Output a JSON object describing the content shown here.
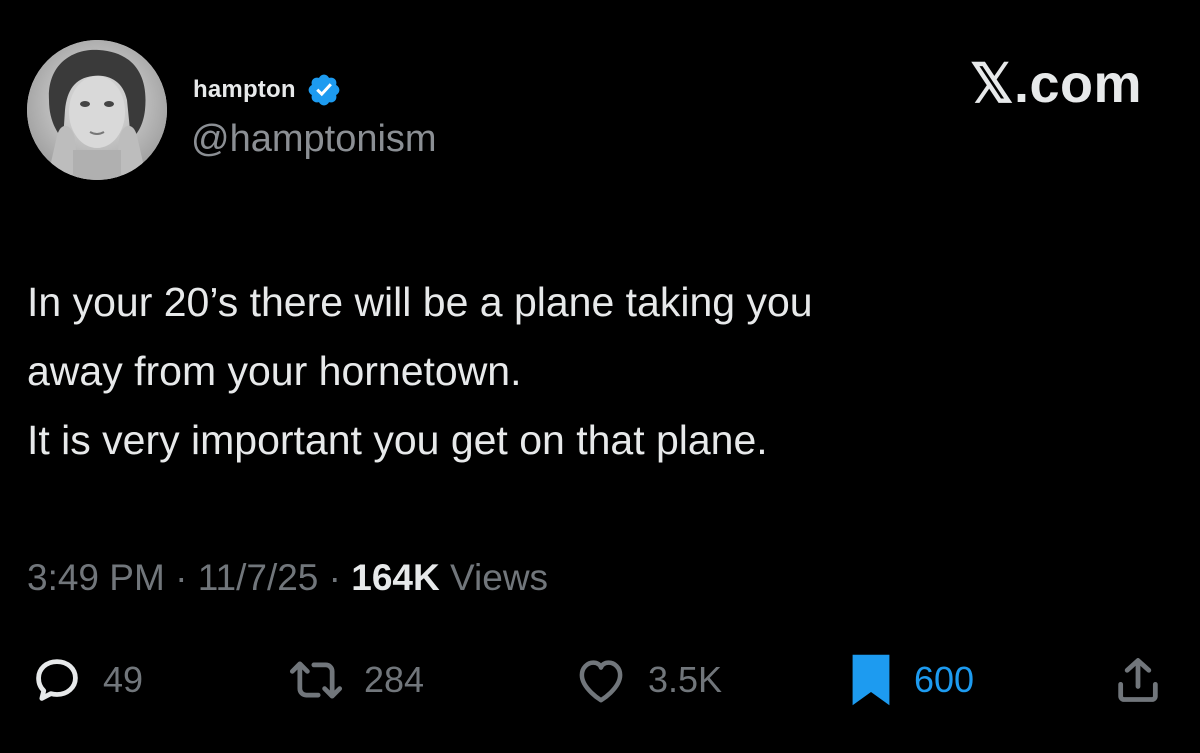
{
  "author": {
    "display_name": "hampton",
    "handle": "@hamptonism",
    "verified": true
  },
  "brand": "𝕏.com",
  "tweet": {
    "lines": [
      "In your 20’s there will be a plane taking you",
      "away from your hornetown.",
      "It is very important you get on that plane."
    ],
    "time": "3:49 PM",
    "date": "11/7/25",
    "separator": "·",
    "views_count": "164K",
    "views_label": "Views"
  },
  "actions": {
    "replies": "49",
    "reposts": "284",
    "likes": "3.5K",
    "bookmarks": "600"
  },
  "icons": {
    "reply": "reply-icon",
    "repost": "repost-icon",
    "like": "heart-icon",
    "bookmark": "bookmark-icon",
    "share": "share-icon",
    "verified": "verified-badge-icon"
  },
  "colors": {
    "background": "#000000",
    "text": "#e7e9ea",
    "muted": "#71767b",
    "accent": "#1d9bf0"
  }
}
